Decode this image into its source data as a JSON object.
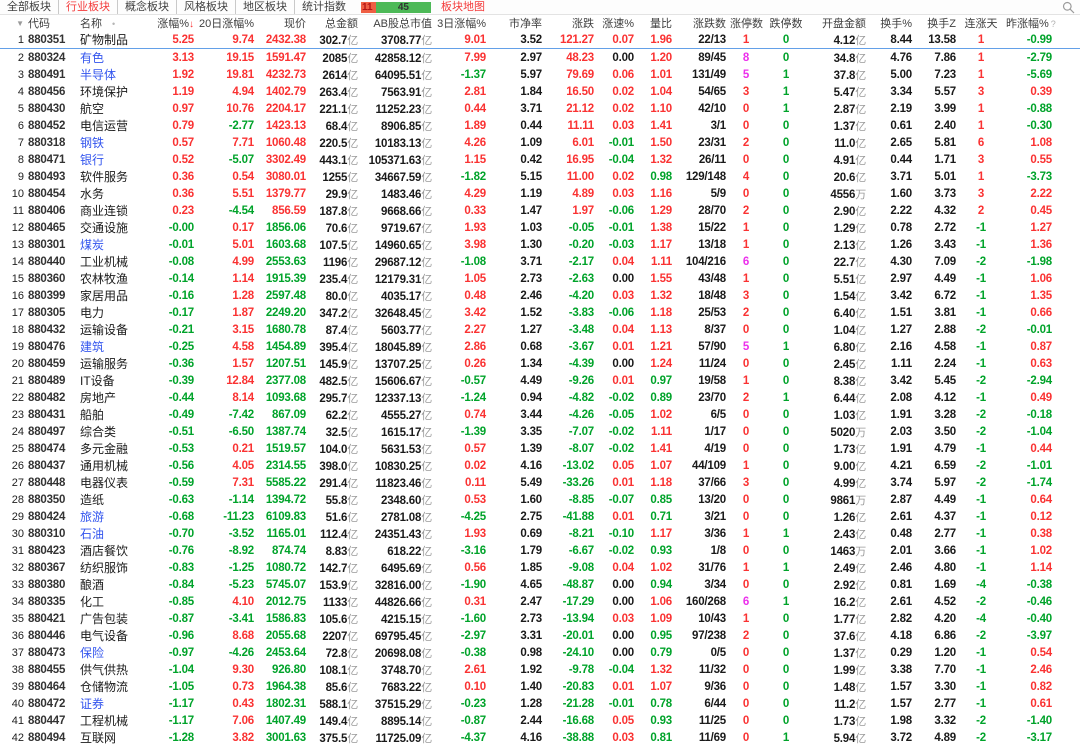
{
  "tabbar": {
    "tabs": [
      {
        "label": "全部板块",
        "active": false
      },
      {
        "label": "行业板块",
        "active": true
      },
      {
        "label": "概念板块",
        "active": false
      },
      {
        "label": "风格板块",
        "active": false
      },
      {
        "label": "地区板块",
        "active": false
      },
      {
        "label": "统计指数",
        "active": false
      }
    ],
    "adv_decl": {
      "up": "11",
      "down": "45"
    },
    "map_link": "板块地图"
  },
  "colors": {
    "up_red": "#fa3232",
    "down_green": "#00a32a",
    "limit_up_magenta": "#ec2fec",
    "name_blue": "#3355ee",
    "tab_active_red": "#f43b3b",
    "adbar_red": "#ef5f44",
    "adbar_green": "#4db957",
    "selected_row_line": "#63a0e8"
  },
  "table": {
    "headers": [
      "代码",
      "名称",
      "涨幅%",
      "20日涨幅%",
      "现价",
      "总金额",
      "AB股总市值",
      "3日涨幅%",
      "市净率",
      "涨跌",
      "涨速%",
      "量比",
      "涨跌数",
      "涨停数",
      "跌停数",
      "开盘金额",
      "换手%",
      "换手Z",
      "连涨天",
      "昨涨幅%"
    ],
    "sort_column": "涨幅%",
    "sort_direction": "desc",
    "selected_row_index": 0,
    "blue_name_rows": [
      1,
      2,
      6,
      7,
      12,
      18,
      28,
      29,
      36,
      39
    ],
    "rows": [
      [
        "880351",
        "矿物制品",
        "5.25",
        "9.74",
        "2432.38",
        "302.7亿",
        "3708.77亿",
        "9.01",
        "3.52",
        "121.27",
        "0.07",
        "1.96",
        "22/13",
        "1",
        "0",
        "4.12亿",
        "8.44",
        "13.58",
        "1",
        "-0.99"
      ],
      [
        "880324",
        "有色",
        "3.13",
        "19.15",
        "1591.47",
        "2085亿",
        "42858.12亿",
        "7.99",
        "2.97",
        "48.23",
        "0.00",
        "1.20",
        "89/45",
        "8",
        "0",
        "34.8亿",
        "4.76",
        "7.86",
        "1",
        "-2.79"
      ],
      [
        "880491",
        "半导体",
        "1.92",
        "19.81",
        "4232.73",
        "2614亿",
        "64095.51亿",
        "-1.37",
        "5.97",
        "79.69",
        "0.06",
        "1.01",
        "131/49",
        "5",
        "1",
        "37.8亿",
        "5.00",
        "7.23",
        "1",
        "-5.69"
      ],
      [
        "880456",
        "环境保护",
        "1.19",
        "4.94",
        "1402.79",
        "263.4亿",
        "7563.91亿",
        "2.81",
        "1.84",
        "16.50",
        "0.02",
        "1.04",
        "54/65",
        "3",
        "1",
        "5.47亿",
        "3.34",
        "5.57",
        "3",
        "0.39"
      ],
      [
        "880430",
        "航空",
        "0.97",
        "10.76",
        "2204.17",
        "221.1亿",
        "11252.23亿",
        "0.44",
        "3.71",
        "21.12",
        "0.02",
        "1.10",
        "42/10",
        "0",
        "1",
        "2.87亿",
        "2.19",
        "3.99",
        "1",
        "-0.88"
      ],
      [
        "880452",
        "电信运营",
        "0.79",
        "-2.77",
        "1423.13",
        "68.4亿",
        "8906.85亿",
        "1.89",
        "0.44",
        "11.11",
        "0.03",
        "1.41",
        "3/1",
        "0",
        "0",
        "1.37亿",
        "0.61",
        "2.40",
        "1",
        "-0.30"
      ],
      [
        "880318",
        "钢铁",
        "0.57",
        "7.71",
        "1060.48",
        "220.5亿",
        "10183.13亿",
        "4.26",
        "1.09",
        "6.01",
        "-0.01",
        "1.50",
        "23/31",
        "2",
        "0",
        "11.0亿",
        "2.65",
        "5.81",
        "6",
        "1.08"
      ],
      [
        "880471",
        "银行",
        "0.52",
        "-5.07",
        "3302.49",
        "443.1亿",
        "105371.63亿",
        "1.15",
        "0.42",
        "16.95",
        "-0.04",
        "1.32",
        "26/11",
        "0",
        "0",
        "4.91亿",
        "0.44",
        "1.71",
        "3",
        "0.55"
      ],
      [
        "880493",
        "软件服务",
        "0.36",
        "0.54",
        "3080.01",
        "1255亿",
        "34667.59亿",
        "-1.82",
        "5.15",
        "11.00",
        "0.02",
        "0.98",
        "129/148",
        "4",
        "0",
        "20.6亿",
        "3.71",
        "5.01",
        "1",
        "-3.73"
      ],
      [
        "880454",
        "水务",
        "0.36",
        "5.51",
        "1379.77",
        "29.9亿",
        "1483.46亿",
        "4.29",
        "1.19",
        "4.89",
        "0.03",
        "1.16",
        "5/9",
        "0",
        "0",
        "4556万",
        "1.60",
        "3.73",
        "3",
        "2.22"
      ],
      [
        "880406",
        "商业连锁",
        "0.23",
        "-4.54",
        "856.59",
        "187.8亿",
        "9668.66亿",
        "0.33",
        "1.47",
        "1.97",
        "-0.06",
        "1.29",
        "28/70",
        "2",
        "0",
        "2.90亿",
        "2.22",
        "4.32",
        "2",
        "0.45"
      ],
      [
        "880465",
        "交通设施",
        "-0.00",
        "0.17",
        "1856.06",
        "70.6亿",
        "9719.67亿",
        "1.93",
        "1.03",
        "-0.05",
        "-0.01",
        "1.38",
        "15/22",
        "1",
        "0",
        "1.29亿",
        "0.78",
        "2.72",
        "-1",
        "1.27"
      ],
      [
        "880301",
        "煤炭",
        "-0.01",
        "5.01",
        "1603.68",
        "107.5亿",
        "14960.65亿",
        "3.98",
        "1.30",
        "-0.20",
        "-0.03",
        "1.17",
        "13/18",
        "1",
        "0",
        "2.13亿",
        "1.26",
        "3.43",
        "-1",
        "1.36"
      ],
      [
        "880440",
        "工业机械",
        "-0.08",
        "4.99",
        "2553.63",
        "1196亿",
        "29687.12亿",
        "-1.08",
        "3.71",
        "-2.17",
        "0.04",
        "1.11",
        "104/216",
        "6",
        "0",
        "22.7亿",
        "4.30",
        "7.09",
        "-2",
        "-1.98"
      ],
      [
        "880360",
        "农林牧渔",
        "-0.14",
        "1.14",
        "1915.39",
        "235.4亿",
        "12179.31亿",
        "1.05",
        "2.73",
        "-2.63",
        "0.00",
        "1.55",
        "43/48",
        "1",
        "0",
        "5.51亿",
        "2.97",
        "4.49",
        "-1",
        "1.06"
      ],
      [
        "880399",
        "家居用品",
        "-0.16",
        "1.28",
        "2597.48",
        "80.0亿",
        "4035.17亿",
        "0.48",
        "2.46",
        "-4.20",
        "0.03",
        "1.32",
        "18/48",
        "3",
        "0",
        "1.54亿",
        "3.42",
        "6.72",
        "-1",
        "1.35"
      ],
      [
        "880305",
        "电力",
        "-0.17",
        "1.87",
        "2249.20",
        "347.2亿",
        "32648.45亿",
        "3.42",
        "1.52",
        "-3.83",
        "-0.06",
        "1.18",
        "25/53",
        "2",
        "0",
        "6.40亿",
        "1.51",
        "3.81",
        "-1",
        "0.66"
      ],
      [
        "880432",
        "运输设备",
        "-0.21",
        "3.15",
        "1680.78",
        "87.4亿",
        "5603.77亿",
        "2.27",
        "1.27",
        "-3.48",
        "0.04",
        "1.13",
        "8/37",
        "0",
        "0",
        "1.04亿",
        "1.27",
        "2.88",
        "-2",
        "-0.01"
      ],
      [
        "880476",
        "建筑",
        "-0.25",
        "4.58",
        "1454.89",
        "395.4亿",
        "18045.89亿",
        "2.86",
        "0.68",
        "-3.67",
        "0.01",
        "1.21",
        "57/90",
        "5",
        "1",
        "6.80亿",
        "2.16",
        "4.58",
        "-1",
        "0.87"
      ],
      [
        "880459",
        "运输服务",
        "-0.36",
        "1.57",
        "1207.51",
        "145.9亿",
        "13707.25亿",
        "0.26",
        "1.34",
        "-4.39",
        "0.00",
        "1.24",
        "11/24",
        "0",
        "0",
        "2.45亿",
        "1.11",
        "2.24",
        "-1",
        "0.63"
      ],
      [
        "880489",
        "IT设备",
        "-0.39",
        "12.84",
        "2377.08",
        "482.5亿",
        "15606.67亿",
        "-0.57",
        "4.49",
        "-9.26",
        "0.01",
        "0.97",
        "19/58",
        "1",
        "0",
        "8.38亿",
        "3.42",
        "5.45",
        "-2",
        "-2.94"
      ],
      [
        "880482",
        "房地产",
        "-0.44",
        "8.14",
        "1093.68",
        "295.7亿",
        "12337.13亿",
        "-1.24",
        "0.94",
        "-4.82",
        "-0.02",
        "0.89",
        "23/70",
        "2",
        "1",
        "6.44亿",
        "2.08",
        "4.12",
        "-1",
        "0.49"
      ],
      [
        "880431",
        "船舶",
        "-0.49",
        "-7.42",
        "867.09",
        "62.2亿",
        "4555.27亿",
        "0.74",
        "3.44",
        "-4.26",
        "-0.05",
        "1.02",
        "6/5",
        "0",
        "0",
        "1.03亿",
        "1.91",
        "3.28",
        "-2",
        "-0.18"
      ],
      [
        "880497",
        "综合类",
        "-0.51",
        "-6.50",
        "1387.74",
        "32.5亿",
        "1615.17亿",
        "-1.39",
        "3.35",
        "-7.07",
        "-0.02",
        "1.11",
        "1/17",
        "0",
        "0",
        "5020万",
        "2.03",
        "3.50",
        "-2",
        "-1.04"
      ],
      [
        "880474",
        "多元金融",
        "-0.53",
        "0.21",
        "1519.57",
        "104.0亿",
        "5631.53亿",
        "0.57",
        "1.39",
        "-8.07",
        "-0.02",
        "1.41",
        "4/19",
        "0",
        "0",
        "1.73亿",
        "1.91",
        "4.79",
        "-1",
        "0.44"
      ],
      [
        "880437",
        "通用机械",
        "-0.56",
        "4.05",
        "2314.55",
        "398.0亿",
        "10830.25亿",
        "0.02",
        "4.16",
        "-13.02",
        "0.05",
        "1.07",
        "44/109",
        "1",
        "0",
        "9.00亿",
        "4.21",
        "6.59",
        "-2",
        "-1.01"
      ],
      [
        "880448",
        "电器仪表",
        "-0.59",
        "7.31",
        "5585.22",
        "291.4亿",
        "11823.46亿",
        "0.11",
        "5.49",
        "-33.26",
        "0.01",
        "1.18",
        "37/66",
        "3",
        "0",
        "4.99亿",
        "3.74",
        "5.97",
        "-2",
        "-1.74"
      ],
      [
        "880350",
        "造纸",
        "-0.63",
        "-1.14",
        "1394.72",
        "55.8亿",
        "2348.60亿",
        "0.53",
        "1.60",
        "-8.85",
        "-0.07",
        "0.85",
        "13/20",
        "0",
        "0",
        "9861万",
        "2.87",
        "4.49",
        "-1",
        "0.64"
      ],
      [
        "880424",
        "旅游",
        "-0.68",
        "-11.23",
        "6109.83",
        "51.6亿",
        "2781.08亿",
        "-4.25",
        "2.75",
        "-41.88",
        "0.01",
        "0.71",
        "3/21",
        "0",
        "0",
        "1.26亿",
        "2.61",
        "4.37",
        "-1",
        "0.12"
      ],
      [
        "880310",
        "石油",
        "-0.70",
        "-3.52",
        "1165.01",
        "112.4亿",
        "24351.43亿",
        "1.93",
        "0.69",
        "-8.21",
        "-0.10",
        "1.17",
        "3/36",
        "1",
        "1",
        "2.43亿",
        "0.48",
        "2.77",
        "-1",
        "0.38"
      ],
      [
        "880423",
        "酒店餐饮",
        "-0.76",
        "-8.92",
        "874.74",
        "8.83亿",
        "618.22亿",
        "-3.16",
        "1.79",
        "-6.67",
        "-0.02",
        "0.93",
        "1/8",
        "0",
        "0",
        "1463万",
        "2.01",
        "3.66",
        "-1",
        "1.02"
      ],
      [
        "880367",
        "纺织服饰",
        "-0.83",
        "-1.25",
        "1080.72",
        "142.7亿",
        "6495.69亿",
        "0.56",
        "1.85",
        "-9.08",
        "0.04",
        "1.02",
        "31/76",
        "1",
        "1",
        "2.49亿",
        "2.46",
        "4.80",
        "-1",
        "1.14"
      ],
      [
        "880380",
        "酿酒",
        "-0.84",
        "-5.23",
        "5745.07",
        "153.9亿",
        "32816.00亿",
        "-1.90",
        "4.65",
        "-48.87",
        "0.00",
        "0.94",
        "3/34",
        "0",
        "0",
        "2.92亿",
        "0.81",
        "1.69",
        "-4",
        "-0.38"
      ],
      [
        "880335",
        "化工",
        "-0.85",
        "4.10",
        "2012.75",
        "1133亿",
        "44826.66亿",
        "0.31",
        "2.47",
        "-17.29",
        "0.00",
        "1.06",
        "160/268",
        "6",
        "1",
        "16.2亿",
        "2.61",
        "4.52",
        "-2",
        "-0.46"
      ],
      [
        "880421",
        "广告包装",
        "-0.87",
        "-3.41",
        "1586.83",
        "105.6亿",
        "4215.15亿",
        "-1.60",
        "2.73",
        "-13.94",
        "0.03",
        "1.09",
        "10/43",
        "1",
        "0",
        "1.77亿",
        "2.82",
        "4.20",
        "-4",
        "-0.40"
      ],
      [
        "880446",
        "电气设备",
        "-0.96",
        "8.68",
        "2055.68",
        "2207亿",
        "69795.45亿",
        "-2.97",
        "3.31",
        "-20.01",
        "0.00",
        "0.95",
        "97/238",
        "2",
        "0",
        "37.6亿",
        "4.18",
        "6.86",
        "-2",
        "-3.97"
      ],
      [
        "880473",
        "保险",
        "-0.97",
        "-4.26",
        "2453.64",
        "72.8亿",
        "20698.08亿",
        "-0.38",
        "0.98",
        "-24.10",
        "0.00",
        "0.79",
        "0/5",
        "0",
        "0",
        "1.37亿",
        "0.29",
        "1.20",
        "-1",
        "0.54"
      ],
      [
        "880455",
        "供气供热",
        "-1.04",
        "9.30",
        "926.80",
        "108.1亿",
        "3748.70亿",
        "2.61",
        "1.92",
        "-9.78",
        "-0.04",
        "1.32",
        "11/32",
        "0",
        "0",
        "1.99亿",
        "3.38",
        "7.70",
        "-1",
        "2.46"
      ],
      [
        "880464",
        "仓储物流",
        "-1.05",
        "0.73",
        "1964.38",
        "85.6亿",
        "7683.22亿",
        "0.10",
        "1.40",
        "-20.83",
        "0.01",
        "1.07",
        "9/36",
        "0",
        "0",
        "1.48亿",
        "1.57",
        "3.30",
        "-1",
        "0.82"
      ],
      [
        "880472",
        "证券",
        "-1.17",
        "0.43",
        "1802.31",
        "588.1亿",
        "37515.29亿",
        "-0.23",
        "1.28",
        "-21.28",
        "-0.01",
        "0.78",
        "6/44",
        "0",
        "0",
        "11.2亿",
        "1.57",
        "2.77",
        "-1",
        "0.61"
      ],
      [
        "880447",
        "工程机械",
        "-1.17",
        "7.06",
        "1407.49",
        "149.4亿",
        "8895.14亿",
        "-0.87",
        "2.44",
        "-16.68",
        "0.05",
        "0.93",
        "11/25",
        "0",
        "0",
        "1.73亿",
        "1.98",
        "3.32",
        "-2",
        "-1.40"
      ],
      [
        "880494",
        "互联网",
        "-1.28",
        "3.82",
        "3001.63",
        "375.5亿",
        "11725.09亿",
        "-4.37",
        "4.16",
        "-38.88",
        "0.03",
        "0.81",
        "11/69",
        "0",
        "1",
        "5.94亿",
        "3.72",
        "4.89",
        "-2",
        "-3.17"
      ]
    ]
  }
}
